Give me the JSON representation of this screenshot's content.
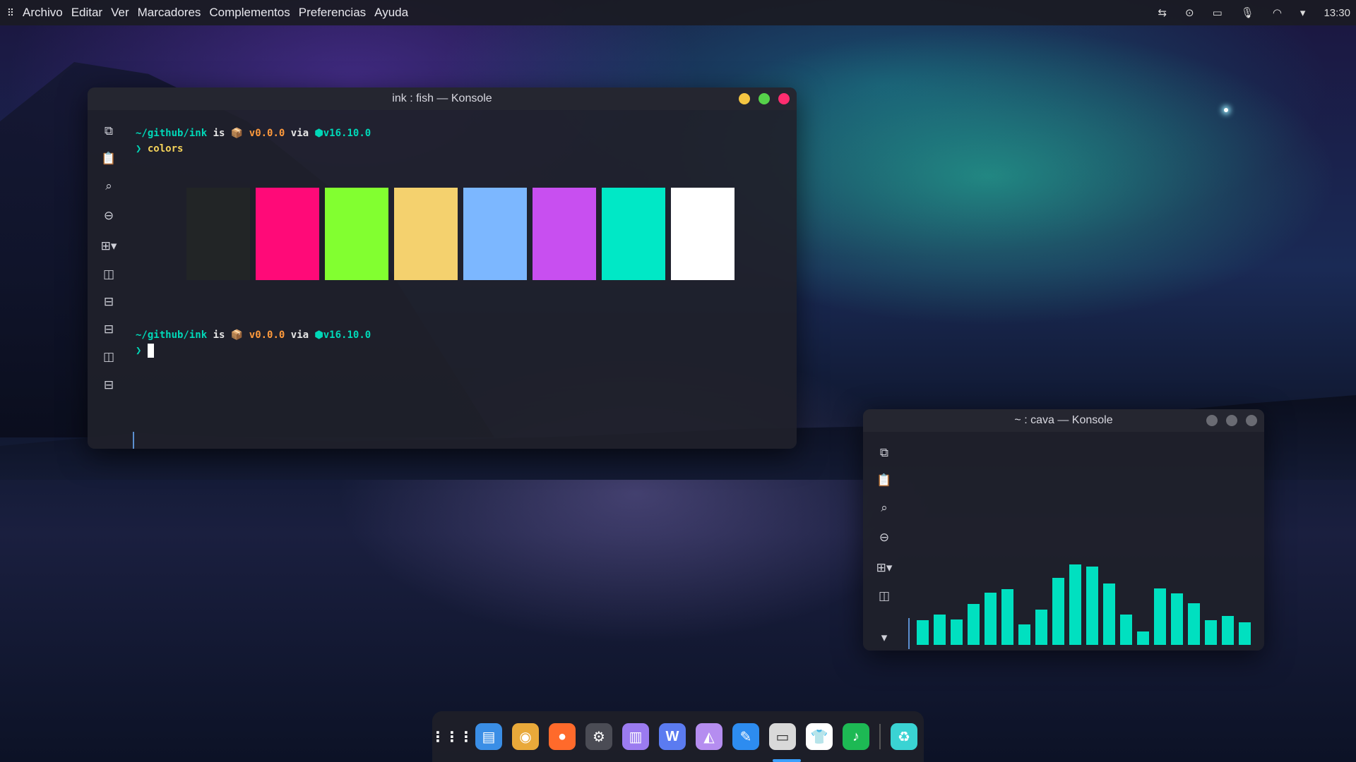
{
  "menubar": {
    "apps_icon": "grid-icon",
    "items": [
      "Archivo",
      "Editar",
      "Ver",
      "Marcadores",
      "Complementos",
      "Preferencias",
      "Ayuda"
    ],
    "tray_icons": [
      "transfer-icon",
      "media-icon",
      "battery-icon",
      "microphone-icon",
      "wifi-icon",
      "chevron-down-icon"
    ],
    "clock": "13:30"
  },
  "main_window": {
    "title": "ink : fish — Konsole",
    "controls": {
      "minimize": "#f5c542",
      "maximize": "#56d14a",
      "close": "#ff2d6f"
    },
    "prompt": {
      "path": "~/github/ink",
      "is": "is",
      "pkg_icon": "📦",
      "version": "v0.0.0",
      "via": "via",
      "node_icon": "⬢",
      "node_version": "v16.10.0",
      "chevron": "❯",
      "command": "colors"
    },
    "swatches": [
      "#222526",
      "#ff0a78",
      "#82ff30",
      "#f4d16e",
      "#7cb7ff",
      "#c84ff0",
      "#00e8c6",
      "#ffffff"
    ]
  },
  "cava_window": {
    "title": "~ : cava — Konsole",
    "controls": {
      "minimize": "#6a6b73",
      "maximize": "#6a6b73",
      "close": "#6a6b73"
    },
    "bars": [
      0.31,
      0.38,
      0.32,
      0.51,
      0.65,
      0.69,
      0.25,
      0.44,
      0.83,
      1.0,
      0.97,
      0.76,
      0.38,
      0.17,
      0.7,
      0.64,
      0.52,
      0.31,
      0.36,
      0.28
    ]
  },
  "dock": {
    "apps": [
      {
        "name": "app-grid-icon",
        "color": "transparent",
        "glyph": "⋮⋮⋮"
      },
      {
        "name": "files-icon",
        "color": "#3a8ee6",
        "glyph": "▤"
      },
      {
        "name": "chrome-icon",
        "color": "#e9a93a",
        "glyph": "◉"
      },
      {
        "name": "firefox-icon",
        "color": "#ff6a2b",
        "glyph": "●"
      },
      {
        "name": "settings-icon",
        "color": "#4b4c55",
        "glyph": "⚙"
      },
      {
        "name": "store-icon",
        "color": "#9b7bf0",
        "glyph": "▥"
      },
      {
        "name": "word-icon",
        "color": "#5b7bf0",
        "glyph": "W"
      },
      {
        "name": "photos-icon",
        "color": "#b58df0",
        "glyph": "◭"
      },
      {
        "name": "design-icon",
        "color": "#2d8cf0",
        "glyph": "✎"
      },
      {
        "name": "terminal-icon",
        "color": "#d9d9d9",
        "glyph": "▭"
      },
      {
        "name": "shirt-icon",
        "color": "#ffffff",
        "glyph": "👕"
      },
      {
        "name": "spotify-icon",
        "color": "#1db954",
        "glyph": "♪"
      },
      {
        "name": "trash-icon",
        "color": "#3ad3d3",
        "glyph": "♻"
      }
    ]
  }
}
